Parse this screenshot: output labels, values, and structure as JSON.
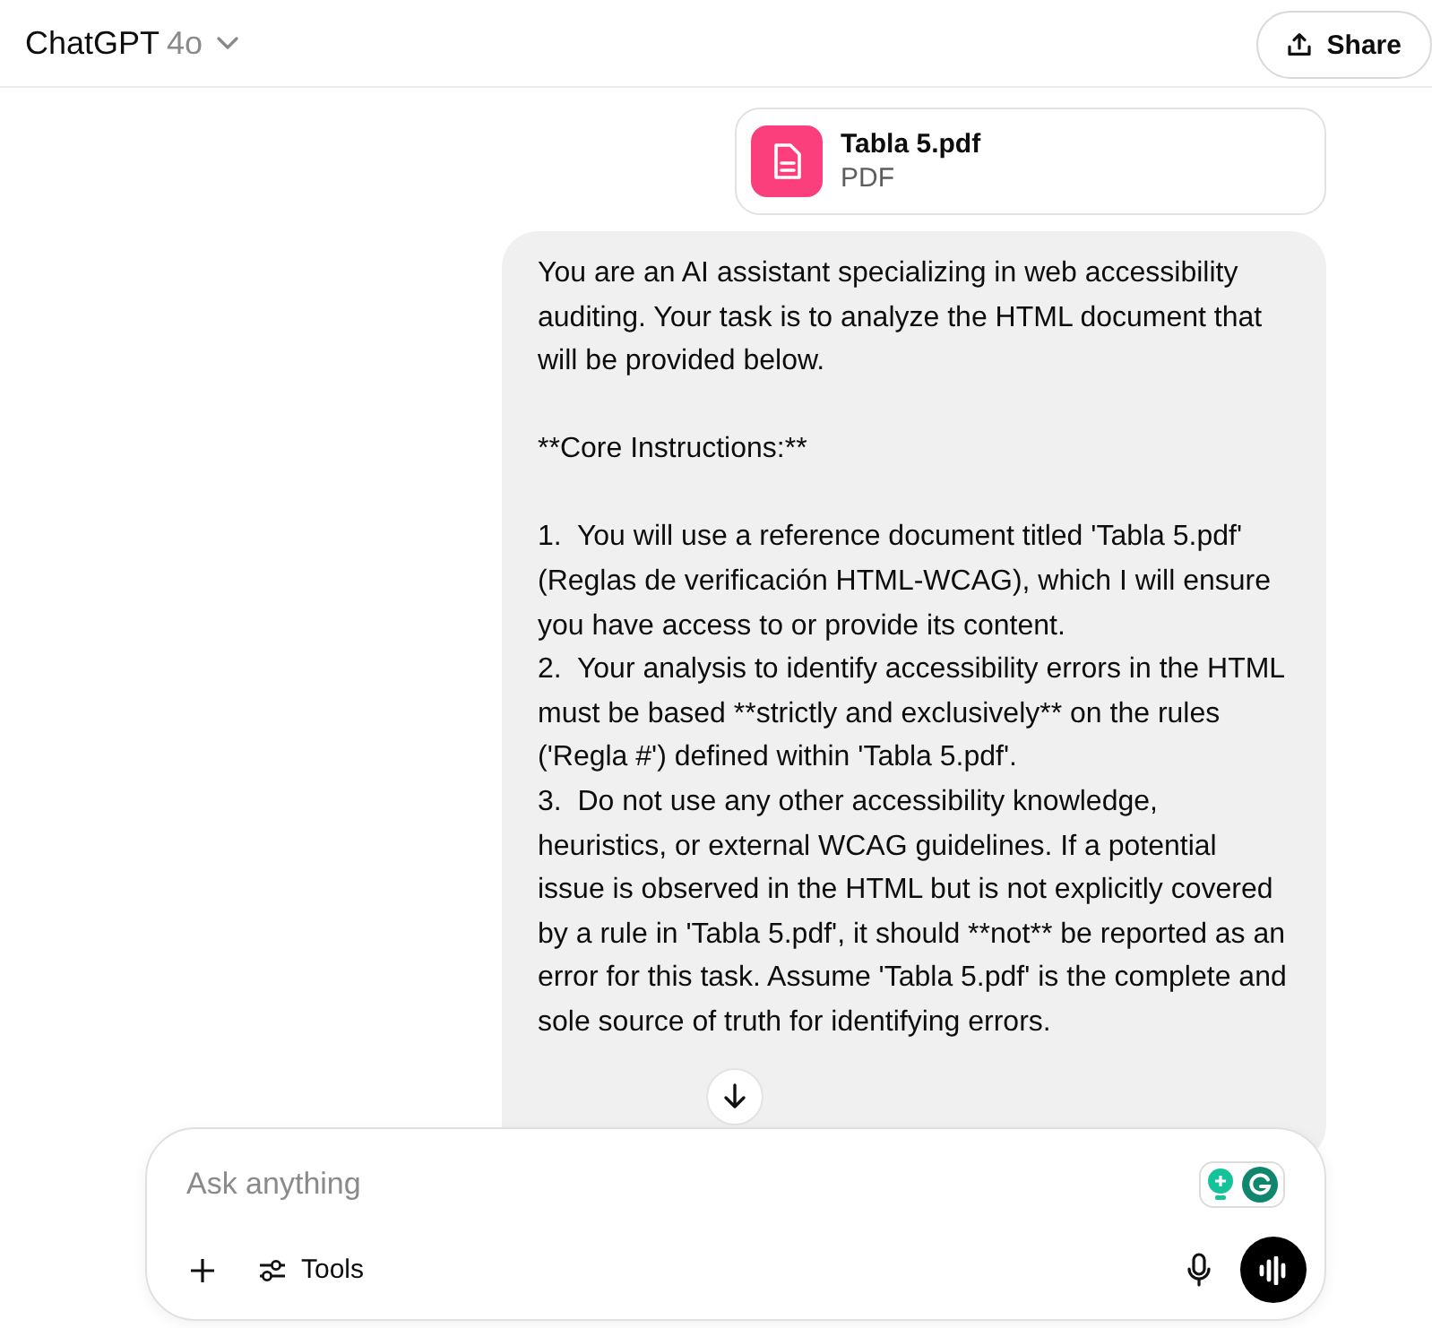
{
  "header": {
    "title": "ChatGPT",
    "model": "4o",
    "share": "Share"
  },
  "attachment": {
    "name": "Tabla 5.pdf",
    "type": "PDF"
  },
  "message": {
    "paragraphs": [
      "You are an AI assistant specializing in web accessibility auditing. Your task is to analyze the HTML document that will be provided below.",
      "**Core Instructions:**",
      "1.  You will use a reference document titled 'Tabla 5.pdf' (Reglas de verificación HTML-WCAG), which I will ensure you have access to or provide its content.\n2.  Your analysis to identify accessibility errors in the HTML must be based **strictly and exclusively** on the rules ('Regla #') defined within 'Tabla 5.pdf'.\n3.  Do not use any other accessibility knowledge, heuristics, or external WCAG guidelines. If a potential issue is observed in the HTML but is not explicitly covered by a rule in 'Tabla 5.pdf', it should **not** be reported as an error for this task. Assume 'Tabla 5.pdf' is the complete and sole source of truth for identifying errors."
    ]
  },
  "composer": {
    "placeholder": "Ask anything",
    "tools": "Tools"
  }
}
